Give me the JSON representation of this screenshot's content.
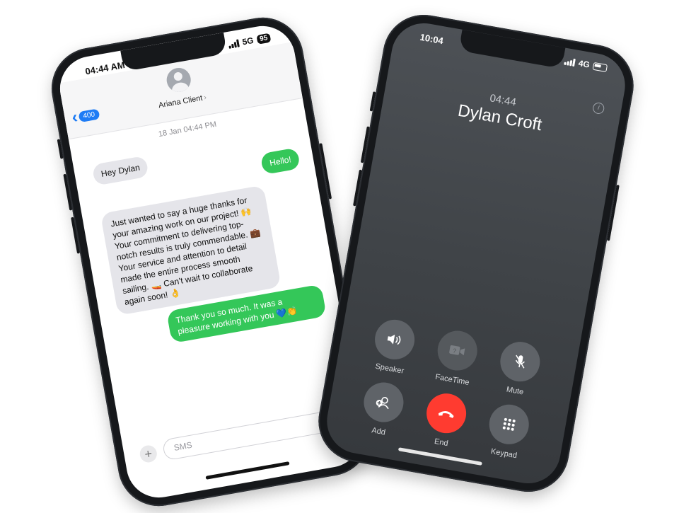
{
  "messages_phone": {
    "status": {
      "time": "04:44 AM",
      "network": "5G",
      "battery": "95"
    },
    "header": {
      "back_count": "400",
      "contact_name": "Ariana Client"
    },
    "date_line": "18 Jan 04:44 PM",
    "bubbles": [
      {
        "direction": "incoming",
        "text": "Hey Dylan"
      },
      {
        "direction": "outgoing",
        "text": "Hello!"
      },
      {
        "direction": "incoming",
        "text": "Just wanted to say a huge thanks for your amazing work on our project! 🙌 Your commitment to delivering top-notch results is truly commendable. 💼 Your service and attention to detail made the entire process smooth sailing. 🚤 Can't wait to collaborate again soon! 👌"
      },
      {
        "direction": "outgoing",
        "text": "Thank you so much. It was a pleasure working with you 💙👏"
      }
    ],
    "compose": {
      "placeholder": "SMS"
    },
    "colors": {
      "incoming": "#e5e5ea",
      "outgoing": "#34c759",
      "accent": "#1e7cf5"
    }
  },
  "call_phone": {
    "status": {
      "time": "10:04",
      "network": "4G"
    },
    "call": {
      "timer": "04:44",
      "caller": "Dylan Croft"
    },
    "controls": {
      "speaker": "Speaker",
      "facetime": "FaceTime",
      "mute": "Mute",
      "add": "Add",
      "end": "End",
      "keypad": "Keypad"
    },
    "colors": {
      "end": "#ff3b30"
    }
  }
}
